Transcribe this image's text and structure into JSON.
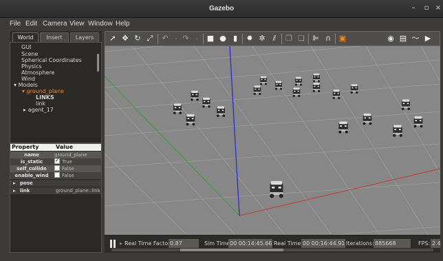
{
  "window": {
    "title": "Gazebo",
    "minimize": "–",
    "maximize": "▫",
    "close": "×"
  },
  "menu": [
    "File",
    "Edit",
    "Camera",
    "View",
    "Window",
    "Help"
  ],
  "tabs": [
    "World",
    "Insert",
    "Layers"
  ],
  "tree": {
    "gui": "GUI",
    "scene": "Scene",
    "spherical": "Spherical Coordinates",
    "physics": "Physics",
    "atmosphere": "Atmosphere",
    "wind": "Wind",
    "models": "Models",
    "ground_plane": "ground_plane",
    "links_header": "LINKS",
    "link": "link",
    "agent": "agent_17"
  },
  "properties": {
    "head_property": "Property",
    "head_value": "Value",
    "rows": [
      {
        "key": "name",
        "value": "ground_plane"
      },
      {
        "key": "is_static",
        "value": "True"
      },
      {
        "key": "self_collide",
        "value": "False"
      },
      {
        "key": "enable_wind",
        "value": "False"
      }
    ],
    "pose": "pose",
    "link": "link",
    "link_value": "ground_plane::link"
  },
  "toolbar_icons": [
    "select-icon",
    "translate-icon",
    "rotate-icon",
    "scale-icon",
    "undo-icon",
    "undo-dropdown-icon",
    "redo-icon",
    "redo-dropdown-icon",
    "box-icon",
    "sphere-icon",
    "cylinder-icon",
    "point-light-icon",
    "spot-light-icon",
    "directional-light-icon",
    "copy-icon",
    "paste-icon",
    "align-icon",
    "snap-icon",
    "change-view-icon",
    "screenshot-icon",
    "log-icon",
    "plot-icon",
    "video-icon"
  ],
  "status": {
    "rtf_label": "Real Time Factor:",
    "rtf_value": "0.87",
    "sim_label": "Sim Time:",
    "sim_value": "00 00:14:45.668",
    "real_label": "Real Time:",
    "real_value": "00 00:16:44.916",
    "iter_label": "Iterations:",
    "iter_value": "885668",
    "fps_label": "FPS:",
    "fps_value": "2.4"
  },
  "colors": {
    "viewport": "#878787",
    "selected": "#e88a2a",
    "x_axis": "#c23b3b",
    "y_axis": "#2f8f2f",
    "z_axis": "#2b2bd6"
  }
}
